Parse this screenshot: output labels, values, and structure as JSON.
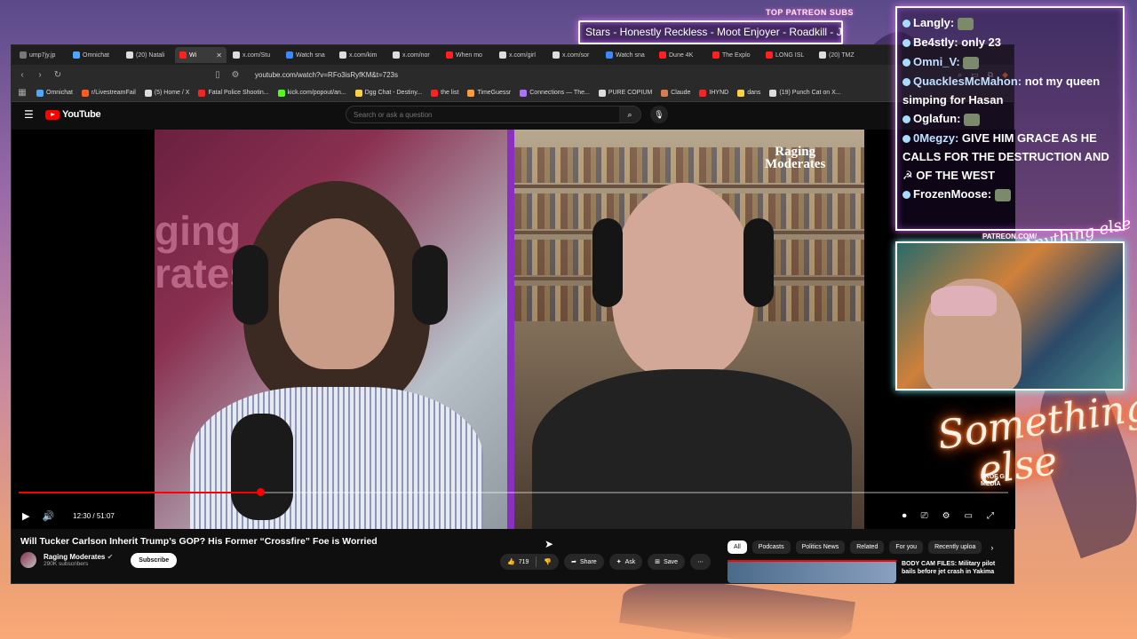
{
  "stream": {
    "patreon_label": "TOP PATREON SUBS",
    "patreon_ticker": "Stars - Honestly Reckless - Moot Enjoyer - Roadkill - JRB",
    "patreon_url": "PATREON.COM/",
    "patreon_script": "Anything else",
    "brand_line1": "Something",
    "brand_line2": "else",
    "prof_label": "PROF G MEDIA"
  },
  "browser": {
    "tabs": [
      {
        "label": "ump7jy.jp",
        "color": "#777777"
      },
      {
        "label": "Omnichat",
        "color": "#4aa8ff"
      },
      {
        "label": "(20) Natali",
        "color": "#dddddd"
      },
      {
        "label": "Wi",
        "color": "#ff2020",
        "active": true
      },
      {
        "label": "x.com/Stu",
        "color": "#dddddd"
      },
      {
        "label": "Watch sna",
        "color": "#3a8aff"
      },
      {
        "label": "x.com/kim",
        "color": "#dddddd"
      },
      {
        "label": "x.com/nor",
        "color": "#dddddd"
      },
      {
        "label": "When mo",
        "color": "#ff2020"
      },
      {
        "label": "x.com/girl",
        "color": "#dddddd"
      },
      {
        "label": "x.com/sor",
        "color": "#dddddd"
      },
      {
        "label": "Watch sna",
        "color": "#3a8aff"
      },
      {
        "label": "Dune 4K",
        "color": "#ff2020"
      },
      {
        "label": "The Explo",
        "color": "#ff2020"
      },
      {
        "label": "LONG ISL",
        "color": "#ff2020"
      },
      {
        "label": "(20) TMZ",
        "color": "#dddddd"
      }
    ],
    "url": "youtube.com/watch?v=RFo3isRyfKM&t=723s",
    "bookmarks": [
      {
        "label": "Omnichat",
        "color": "#4aa8ff"
      },
      {
        "label": "r/LivestreamFail",
        "color": "#ff5a20"
      },
      {
        "label": "(5) Home / X",
        "color": "#dddddd"
      },
      {
        "label": "Fatal Police Shootin...",
        "color": "#ff2020"
      },
      {
        "label": "kick.com/popout/an...",
        "color": "#53fc18"
      },
      {
        "label": "Dgg Chat - Destiny...",
        "color": "#ffd040"
      },
      {
        "label": "the list",
        "color": "#ff2020"
      },
      {
        "label": "TimeGuessr",
        "color": "#ff9a3a"
      },
      {
        "label": "Connections — The...",
        "color": "#b070ff"
      },
      {
        "label": "PURE COPIUM",
        "color": "#dddddd"
      },
      {
        "label": "Claude",
        "color": "#d97a50"
      },
      {
        "label": "IHYND",
        "color": "#ff2020"
      },
      {
        "label": "dans",
        "color": "#ffd040"
      },
      {
        "label": "(19) Punch Cat on X...",
        "color": "#dddddd"
      }
    ]
  },
  "youtube": {
    "logo_text": "YouTube",
    "search_placeholder": "Search or ask a question",
    "video": {
      "watermark_line1": "Raging",
      "watermark_line2": "Moderates",
      "bg_word": "ging\nrates",
      "time": "12:30 / 51:07",
      "progress": 0.2445
    },
    "title": "Will Tucker Carlson Inherit Trump’s GOP? His Former “Crossfire” Foe is Worried",
    "channel": {
      "name": "Raging Moderates",
      "subscribers": "290K subscribers",
      "subscribe_label": "Subscribe"
    },
    "actions": {
      "likes": "719",
      "share": "Share",
      "ask": "Ask",
      "save": "Save"
    },
    "chips": [
      {
        "label": "All",
        "active": true
      },
      {
        "label": "Podcasts"
      },
      {
        "label": "Politics News"
      },
      {
        "label": "Related"
      },
      {
        "label": "For you"
      },
      {
        "label": "Recently uploa"
      }
    ],
    "recommendation": {
      "title": "BODY CAM FILES: Military pilot bails before jet crash in Yakima"
    }
  },
  "chat": [
    {
      "name": "Langly:",
      "body": ""
    },
    {
      "name": "Be4stly:",
      "body": "only 23"
    },
    {
      "name": "Omni_V:",
      "body": "",
      "color": "blue"
    },
    {
      "name": "QuacklesMcMahon:",
      "body": "not my queen simping for Hasan",
      "color": "blue",
      "wrap": true
    },
    {
      "name": "Oglafun:",
      "body": ""
    },
    {
      "name": "0Megzy:",
      "body": "GIVE HIM GRACE AS HE CALLS FOR THE DESTRUCTION AND ☭ OF THE WEST",
      "color": "blue",
      "wrap": true
    },
    {
      "name": "FrozenMoose:",
      "body": ""
    }
  ]
}
